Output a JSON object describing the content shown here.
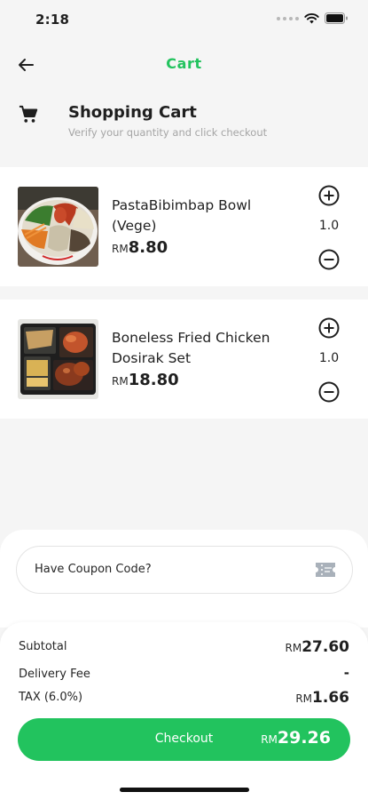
{
  "status_bar": {
    "time": "2:18"
  },
  "nav": {
    "title": "Cart",
    "back_icon": "arrow-left-icon"
  },
  "header": {
    "icon": "cart-icon",
    "title": "Shopping Cart",
    "subtitle": "Verify your quantity and click checkout"
  },
  "items": [
    {
      "name": "PastaBibimbap Bowl (Vege)",
      "currency": "RM",
      "price": "8.80",
      "quantity": "1.0"
    },
    {
      "name": "Boneless Fried Chicken Dosirak Set",
      "currency": "RM",
      "price": "18.80",
      "quantity": "1.0"
    }
  ],
  "coupon": {
    "label": "Have Coupon Code?",
    "icon": "ticket-icon"
  },
  "summary": {
    "subtotal_label": "Subtotal",
    "subtotal_currency": "RM",
    "subtotal_value": "27.60",
    "delivery_label": "Delivery Fee",
    "delivery_value": "-",
    "tax_label": "TAX (6.0%)",
    "tax_currency": "RM",
    "tax_value": "1.66"
  },
  "checkout": {
    "label": "Checkout",
    "currency": "RM",
    "total": "29.26"
  },
  "colors": {
    "accent": "#22c35e",
    "background": "#f5f5f5"
  }
}
